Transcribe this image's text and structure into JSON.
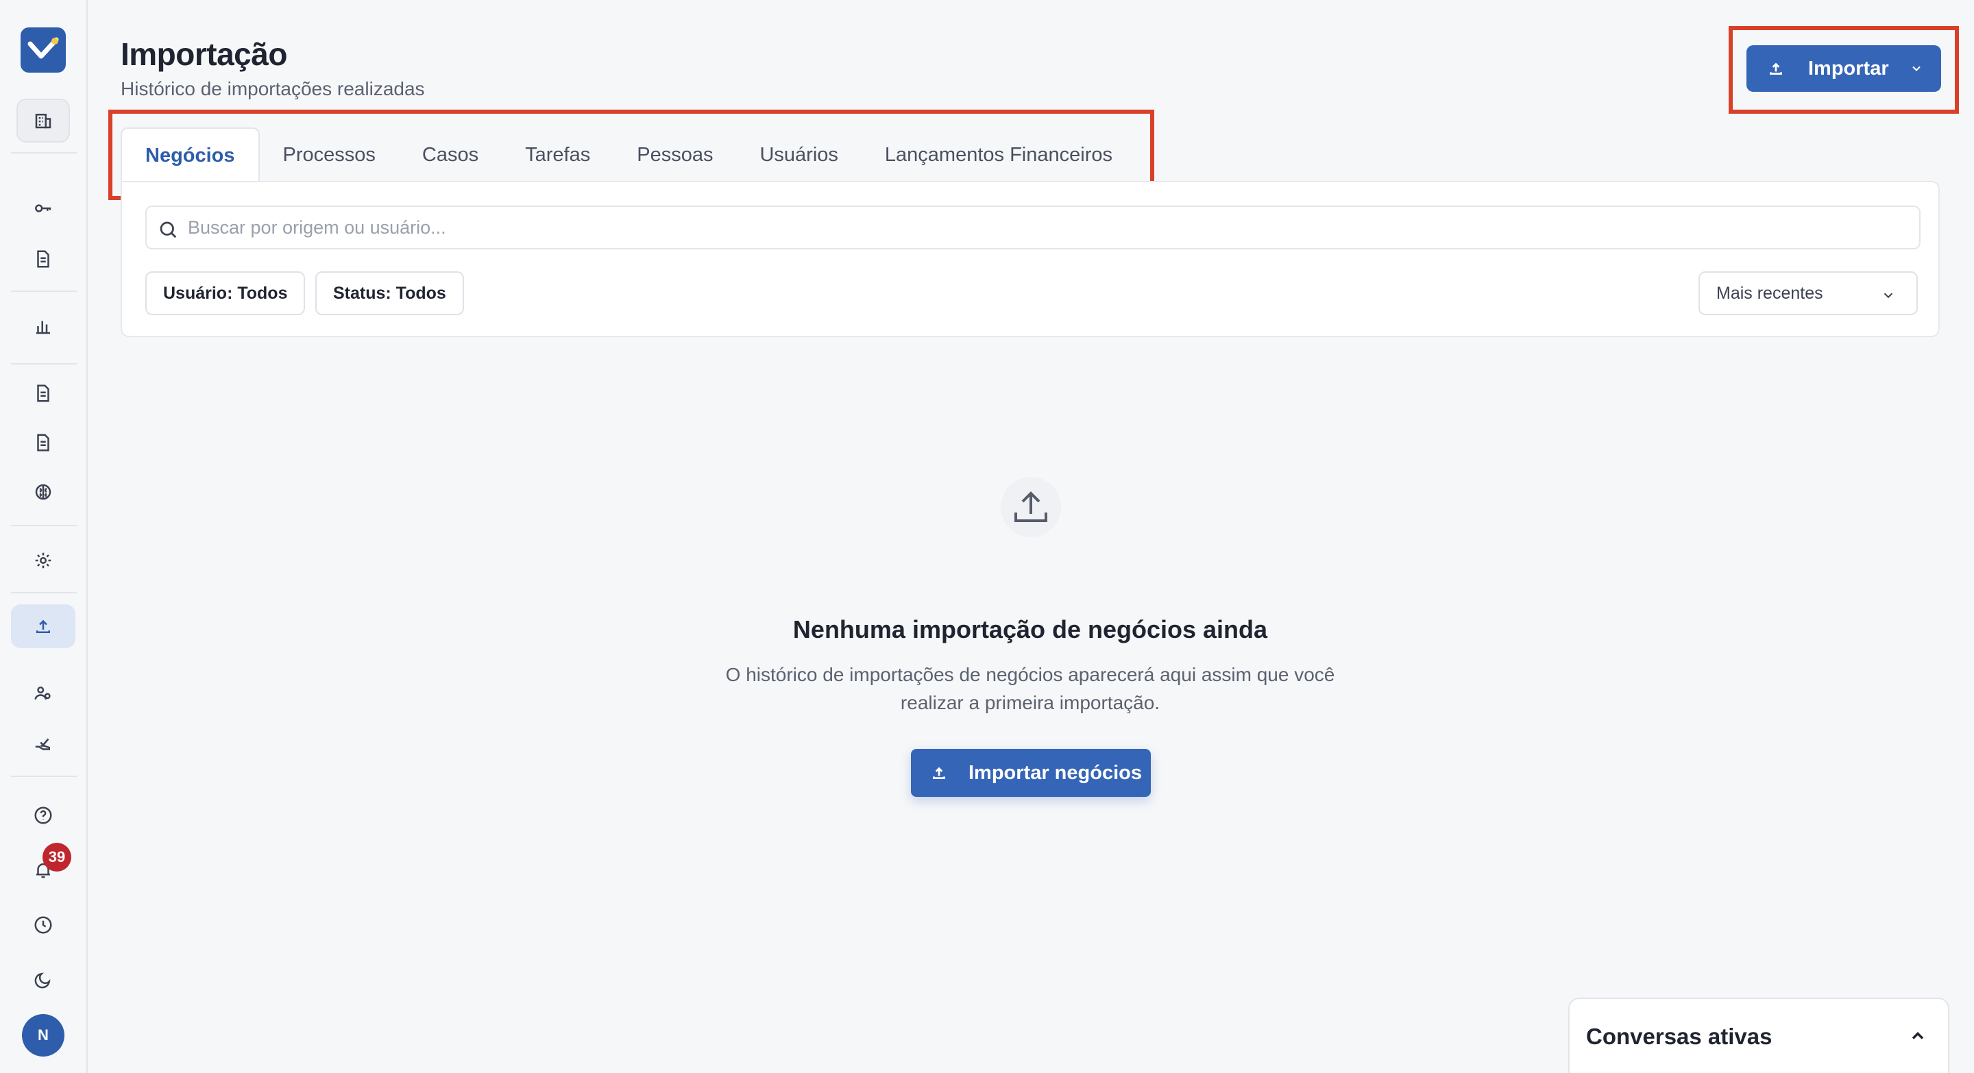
{
  "header": {
    "title": "Importação",
    "subtitle": "Histórico de importações realizadas",
    "import_button_label": "Importar"
  },
  "tabs": [
    {
      "label": "Negócios",
      "active": true
    },
    {
      "label": "Processos",
      "active": false
    },
    {
      "label": "Casos",
      "active": false
    },
    {
      "label": "Tarefas",
      "active": false
    },
    {
      "label": "Pessoas",
      "active": false
    },
    {
      "label": "Usuários",
      "active": false
    },
    {
      "label": "Lançamentos Financeiros",
      "active": false
    }
  ],
  "search": {
    "placeholder": "Buscar por origem ou usuário...",
    "value": ""
  },
  "filters": {
    "user_filter": "Usuário: Todos",
    "status_filter": "Status: Todos",
    "sort_selected": "Mais recentes"
  },
  "empty_state": {
    "title": "Nenhuma importação de negócios ainda",
    "description": "O histórico de importações de negócios aparecerá aqui assim que você realizar a primeira importação.",
    "button_label": "Importar negócios"
  },
  "sidebar": {
    "notification_count": "39",
    "avatar_initial": "N",
    "icons": [
      "building-icon",
      "key-icon",
      "document-icon",
      "bar-chart-icon",
      "document-icon",
      "document-icon",
      "brain-icon",
      "settings-icon",
      "upload-icon",
      "users-icon",
      "hand-check-icon",
      "help-icon",
      "bell-icon",
      "clock-icon",
      "moon-icon"
    ]
  },
  "conversations_panel": {
    "title": "Conversas ativas"
  },
  "colors": {
    "accent": "#3565b6",
    "highlight": "#d9402a",
    "badge": "#c0262d"
  }
}
